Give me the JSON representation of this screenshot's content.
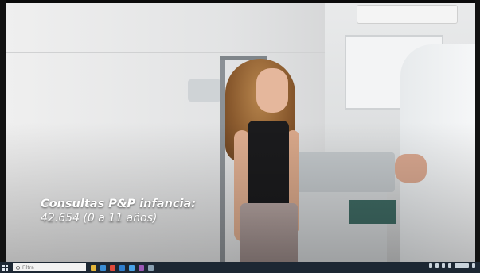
{
  "video": {
    "caption_title": "Consultas P&P infancia:",
    "caption_value": "42.654 (0 a 11 años)"
  },
  "taskbar": {
    "search_placeholder": "Filtra",
    "pinned_apps": [
      {
        "name": "file-explorer-icon",
        "color": "#e3b53a"
      },
      {
        "name": "browser-icon",
        "color": "#3b8ed6"
      },
      {
        "name": "chrome-icon",
        "color": "#e04a3b"
      },
      {
        "name": "mail-icon",
        "color": "#2f7fd0"
      },
      {
        "name": "store-icon",
        "color": "#4aa3e8"
      },
      {
        "name": "media-icon",
        "color": "#9b59b6"
      },
      {
        "name": "settings-icon",
        "color": "#8aa0b2"
      }
    ]
  },
  "colors": {
    "taskbar_bg": "#1c2733",
    "caption_text": "#ffffff"
  }
}
